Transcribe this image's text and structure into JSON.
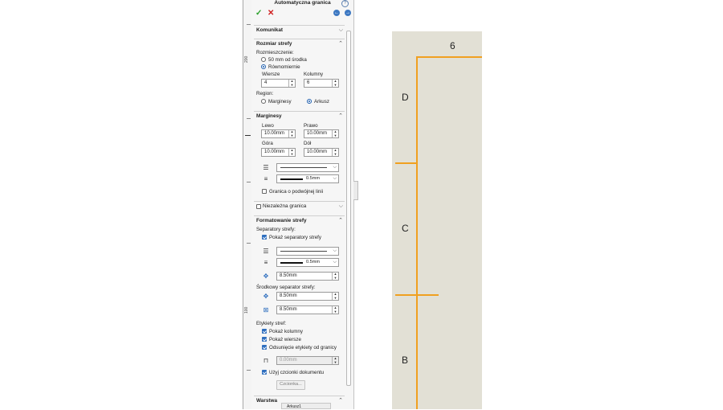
{
  "panel": {
    "title": "Automatyczna granica",
    "help": "?",
    "ok": "✓",
    "cancel": "✕",
    "back": "←",
    "forward": "→"
  },
  "ruler": {
    "labels": [
      "200",
      "100"
    ]
  },
  "sections": {
    "komunikat": {
      "title": "Komunikat",
      "chev": "⌵"
    },
    "rozmiar": {
      "title": "Rozmiar strefy",
      "chev": "⌃",
      "placement_label": "Rozmieszczenie:",
      "option1": "50 mm od środka",
      "option2": "Równomiernie",
      "rows_label": "Wiersze",
      "rows_value": "4",
      "cols_label": "Kolumny",
      "cols_value": "6",
      "region_label": "Region:",
      "region_opt1": "Marginesy",
      "region_opt2": "Arkusz"
    },
    "marginesy": {
      "title": "Marginesy",
      "chev": "⌃",
      "left_label": "Lewo",
      "left_value": "10.00mm",
      "right_label": "Prawo",
      "right_value": "10.00mm",
      "top_label": "Góra",
      "top_value": "10.00mm",
      "bottom_label": "Dół",
      "bottom_value": "10.00mm",
      "thickness_value": "0.5mm",
      "double_label": "Granica o podwójnej linii"
    },
    "niezalezna": {
      "title": "Niezależna granica",
      "chev": "⌵"
    },
    "formatowanie": {
      "title": "Formatowanie strefy",
      "chev": "⌃",
      "separators_label": "Separatory strefy:",
      "show_separators": "Pokaż separatory strefy",
      "thickness_value": "0.5mm",
      "sep_length": "8.50mm",
      "center_label": "Środkowy separator strefy:",
      "center_len1": "8.50mm",
      "center_len2": "8.50mm",
      "labels_label": "Etykiety stref:",
      "show_cols": "Pokaż kolumny",
      "show_rows": "Pokaż wiersze",
      "offset_labels": "Odsunięcie etykiety od granicy",
      "offset_value": "0.00mm",
      "use_font": "Użyj czcionki dokumentu",
      "font_button": "Czcionka..."
    },
    "warstwa": {
      "title": "Warstwa",
      "chev": "⌃"
    }
  },
  "bottom_tab": "Arkusz1",
  "drawing": {
    "column_label": "6",
    "zone_labels": [
      "D",
      "C",
      "B"
    ],
    "border_color": "#f0a020",
    "sheet_color": "#e2e0d5"
  }
}
